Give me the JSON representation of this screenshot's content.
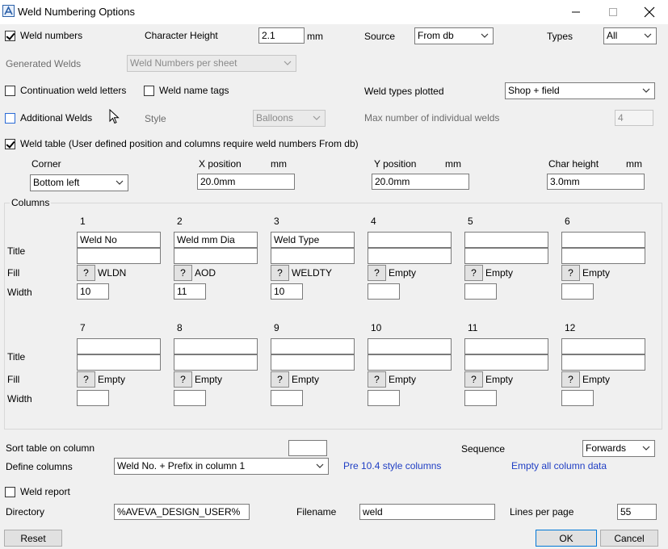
{
  "window": {
    "title": "Weld Numbering Options"
  },
  "row1": {
    "weld_numbers_label": "Weld numbers",
    "char_height_label": "Character Height",
    "char_height_value": "2.1",
    "mm": "mm",
    "source_label": "Source",
    "source_value": "From db",
    "types_label": "Types",
    "types_value": "All"
  },
  "generated": {
    "label": "Generated Welds",
    "value": "Weld Numbers per sheet"
  },
  "row3": {
    "continuation_label": "Continuation weld letters",
    "name_tags_label": "Weld name tags",
    "types_plotted_label": "Weld types plotted",
    "types_plotted_value": "Shop + field"
  },
  "row4": {
    "additional_label": "Additional Welds",
    "style_label": "Style",
    "style_value": "Balloons",
    "max_label": "Max number of individual welds",
    "max_value": "4"
  },
  "weld_table": {
    "label": "Weld table  (User defined position and columns require weld numbers From db)",
    "corner_label": "Corner",
    "corner_value": "Bottom left",
    "xpos_label": "X position",
    "xpos_value": "20.0mm",
    "ypos_label": "Y position",
    "ypos_value": "20.0mm",
    "charh_label": "Char height",
    "charh_value": "3.0mm",
    "mm": "mm"
  },
  "columns": {
    "group_label": "Columns",
    "title_label": "Title",
    "fill_label": "Fill",
    "width_label": "Width",
    "q": "?",
    "row1": [
      {
        "num": "1",
        "title": "Weld No",
        "title2": "",
        "fill": "WLDN",
        "width": "10"
      },
      {
        "num": "2",
        "title": "Weld mm Dia",
        "title2": "",
        "fill": "AOD",
        "width": "11"
      },
      {
        "num": "3",
        "title": "Weld Type",
        "title2": "",
        "fill": "WELDTY",
        "width": "10"
      },
      {
        "num": "4",
        "title": "",
        "title2": "",
        "fill": "Empty",
        "width": ""
      },
      {
        "num": "5",
        "title": "",
        "title2": "",
        "fill": "Empty",
        "width": ""
      },
      {
        "num": "6",
        "title": "",
        "title2": "",
        "fill": "Empty",
        "width": ""
      }
    ],
    "row2": [
      {
        "num": "7",
        "title": "",
        "title2": "",
        "fill": "Empty",
        "width": ""
      },
      {
        "num": "8",
        "title": "",
        "title2": "",
        "fill": "Empty",
        "width": ""
      },
      {
        "num": "9",
        "title": "",
        "title2": "",
        "fill": "Empty",
        "width": ""
      },
      {
        "num": "10",
        "title": "",
        "title2": "",
        "fill": "Empty",
        "width": ""
      },
      {
        "num": "11",
        "title": "",
        "title2": "",
        "fill": "Empty",
        "width": ""
      },
      {
        "num": "12",
        "title": "",
        "title2": "",
        "fill": "Empty",
        "width": ""
      }
    ]
  },
  "bottom": {
    "sort_label": "Sort table on column",
    "sort_value": "",
    "sequence_label": "Sequence",
    "sequence_value": "Forwards",
    "define_label": "Define columns",
    "define_value": "Weld No. + Prefix in column 1",
    "pre104_link": "Pre 10.4 style columns",
    "empty_link": "Empty all column data",
    "report_label": "Weld report",
    "directory_label": "Directory",
    "directory_value": "%AVEVA_DESIGN_USER%",
    "filename_label": "Filename",
    "filename_value": "weld",
    "lines_label": "Lines per page",
    "lines_value": "55"
  },
  "buttons": {
    "reset": "Reset",
    "ok": "OK",
    "cancel": "Cancel"
  }
}
